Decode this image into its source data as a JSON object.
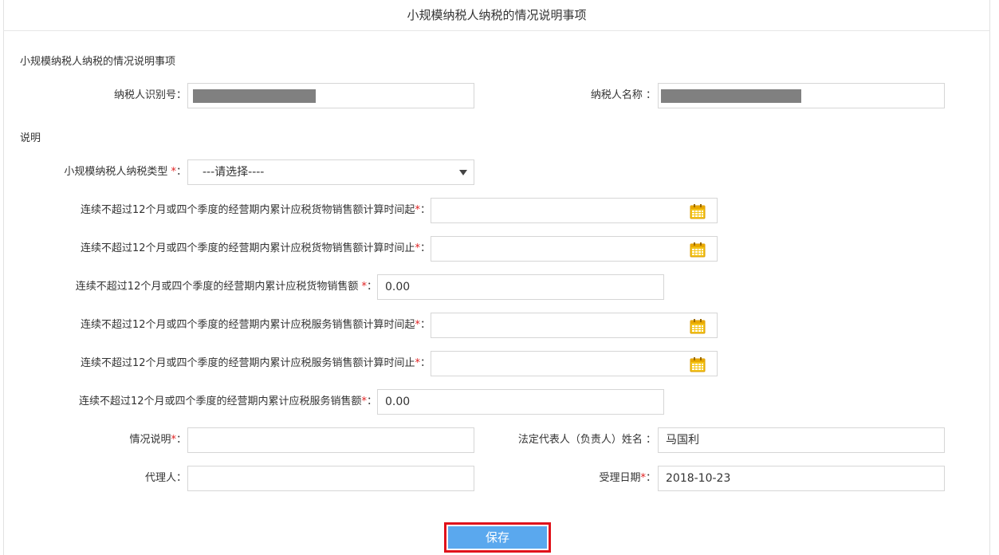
{
  "page_title": "小规模纳税人纳税的情况说明事项",
  "section_title": "小规模纳税人纳税的情况说明事项",
  "taxpayer_id": {
    "label": "纳税人识别号",
    "colon": "："
  },
  "taxpayer_name": {
    "label": "纳税人名称",
    "colon": "："
  },
  "explain_section": "说明",
  "type_field": {
    "label": "小规模纳税人纳税类型",
    "required": "*",
    "colon": "：",
    "selected": "---请选择----"
  },
  "goods_start": {
    "label": "连续不超过12个月或四个季度的经营期内累计应税货物销售额计算时间起",
    "required": "*",
    "colon": "：",
    "value": ""
  },
  "goods_end": {
    "label": "连续不超过12个月或四个季度的经营期内累计应税货物销售额计算时间止",
    "required": "*",
    "colon": "：",
    "value": ""
  },
  "goods_amount": {
    "label": "连续不超过12个月或四个季度的经营期内累计应税货物销售额",
    "required": "*",
    "colon": "：",
    "value": "0.00"
  },
  "service_start": {
    "label": "连续不超过12个月或四个季度的经营期内累计应税服务销售额计算时间起",
    "required": "*",
    "colon": "：",
    "value": ""
  },
  "service_end": {
    "label": "连续不超过12个月或四个季度的经营期内累计应税服务销售额计算时间止",
    "required": "*",
    "colon": "：",
    "value": ""
  },
  "service_amount": {
    "label": "连续不超过12个月或四个季度的经营期内累计应税服务销售额",
    "required": "*",
    "colon": "：",
    "value": "0.00"
  },
  "situation": {
    "label": "情况说明",
    "required": "*",
    "colon": "：",
    "value": ""
  },
  "legal_rep": {
    "label": "法定代表人（负责人）姓名",
    "colon": "：",
    "value": "马国利"
  },
  "agent": {
    "label": "代理人",
    "colon": "：",
    "value": ""
  },
  "accept_date": {
    "label": "受理日期",
    "required": "*",
    "colon": "：",
    "value": "2018-10-23"
  },
  "save_label": "保存",
  "icons": {
    "calendar": "calendar-icon",
    "dropdown": "chevron-down-icon"
  },
  "colors": {
    "required": "#e02020",
    "save_button": "#5aa8ee",
    "highlight_border": "#e0121b",
    "calendar": "#e8a800"
  }
}
